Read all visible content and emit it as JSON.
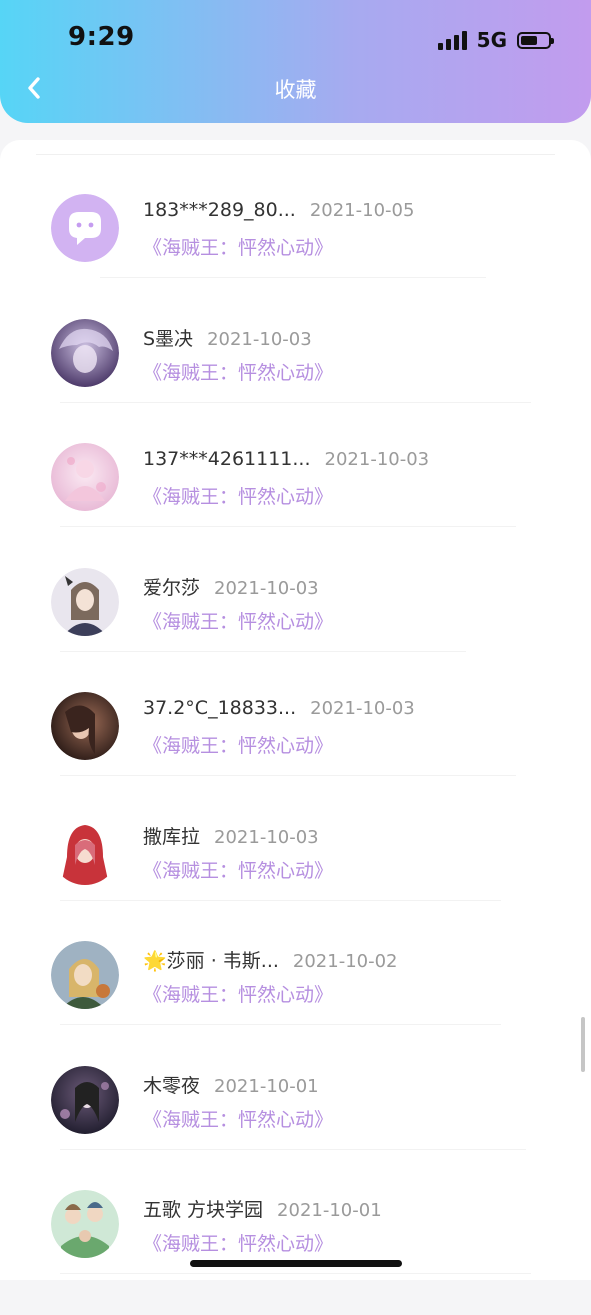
{
  "status_bar": {
    "time": "9:29",
    "network": "5G",
    "battery_level": 0.6,
    "signal_bars": 4
  },
  "header": {
    "title": "收藏",
    "back_icon": "chevron-left-icon"
  },
  "colors": {
    "accent": "#b68fe0",
    "gradient_start": "#56d5f6",
    "gradient_end": "#c29cee"
  },
  "list": [
    {
      "name": "183***289_80...",
      "date": "2021-10-05",
      "source": "《海贼王：怦然心动》",
      "avatar": "chat-bubble-avatar"
    },
    {
      "name": "S墨决",
      "date": "2021-10-03",
      "source": "《海贼王：怦然心动》",
      "avatar": "anime-avatar-purple"
    },
    {
      "name": "137***4261111...",
      "date": "2021-10-03",
      "source": "《海贼王：怦然心动》",
      "avatar": "anime-avatar-pink"
    },
    {
      "name": "爱尔莎",
      "date": "2021-10-03",
      "source": "《海贼王：怦然心动》",
      "avatar": "anime-avatar-grey"
    },
    {
      "name": "37.2°C_18833...",
      "date": "2021-10-03",
      "source": "《海贼王：怦然心动》",
      "avatar": "photo-avatar-dark"
    },
    {
      "name": "撒库拉",
      "date": "2021-10-03",
      "source": "《海贼王：怦然心动》",
      "avatar": "anime-avatar-red-hood"
    },
    {
      "name": "🌟莎丽 · 韦斯...",
      "date": "2021-10-02",
      "source": "《海贼王：怦然心动》",
      "avatar": "painting-avatar-blonde"
    },
    {
      "name": "木零夜",
      "date": "2021-10-01",
      "source": "《海贼王：怦然心动》",
      "avatar": "anime-avatar-dark"
    },
    {
      "name": "五歌 方块学园",
      "date": "2021-10-01",
      "source": "《海贼王：怦然心动》",
      "avatar": "anime-avatar-green"
    }
  ]
}
